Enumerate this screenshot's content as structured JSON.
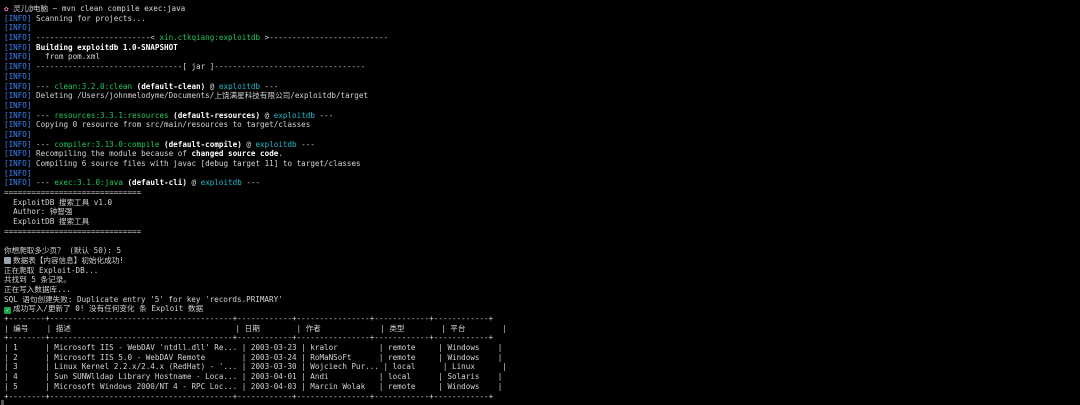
{
  "prompt": {
    "text": "灵儿@电脑 ~ mvn clean compile exec:java"
  },
  "info_tag": "[INFO]",
  "mvn": {
    "scanning": "Scanning for projects...",
    "artifact_prefix": "-------------------------< ",
    "artifact": "xin.ctkqiang:exploitdb",
    "artifact_suffix": " >--------------------------",
    "building": "Building exploitdb 1.0-SNAPSHOT",
    "from_pom": "  from pom.xml",
    "jar_rule": "--------------------------------[ jar ]---------------------------------",
    "clean_dash": "--- ",
    "clean_plugin": "clean:3.2.0:clean",
    "clean_goal": " (default-clean)",
    "at": " @ ",
    "project": "exploitdb",
    "tail_dash": " ---",
    "deleting": "Deleting /Users/johnmelodyme/Documents/上饶满星科技有限公司/exploitdb/target",
    "resources_plugin": "resources:3.3.1:resources",
    "resources_goal": " (default-resources)",
    "copying": "Copying 0 resource from src/main/resources to target/classes",
    "compiler_plugin": "compiler:3.13.0:compile",
    "compiler_goal": " (default-compile)",
    "recompiling_pre": "Recompiling the module because of ",
    "recompiling_bold": "changed source code",
    "recompiling_post": ".",
    "compiling": "Compiling 6 source files with javac [debug target 11] to target/classes",
    "exec_plugin": "exec:3.1.0:java",
    "exec_goal": " (default-cli)"
  },
  "banner": {
    "rule": "==============================",
    "line1": "  ExploitDB 搜索工具 v1.0",
    "line2": "  Author: 钟智强",
    "line3": "  ExploitDB 搜索工具"
  },
  "app": {
    "pages_question": "你想爬取多少页？ (默认 50): 5",
    "db_init": "数据表【内容信息】初始化成功!",
    "crawling": "正在爬取 Exploit-DB...",
    "found": "共找到 5 条记录。",
    "writing": "正在写入数据库...",
    "sql_error": "SQL 语句创建失败: Duplicate entry '5' for key 'records.PRIMARY'",
    "success": "成功写入/更新了 0! 没有任何变化 条 Exploit 数据"
  },
  "table": {
    "border_top": "+--------+----------------------------------------+------------+----------------+------------+------------+",
    "header": "| 编号    | 描述                                    | 日期        | 作者             | 类型        | 平台        |",
    "border_mid": "+--------+----------------------------------------+------------+----------------+------------+------------+",
    "rows": [
      "| 1      | Microsoft IIS - WebDAV 'ntdll.dll' Re... | 2003-03-23 | kralor         | remote     | Windows    |",
      "| 2      | Microsoft IIS 5.0 - WebDAV Remote        | 2003-03-24 | RoMaNSoFt      | remote     | Windows    |",
      "| 3      | Linux Kernel 2.2.x/2.4.x (RedHat) - '... | 2003-03-30 | Wojciech Pur... | local      | Linux      |",
      "| 4      | Sun SUNWlldap Library Hostname - Loca... | 2003-04-01 | Andi           | local      | Solaris    |",
      "| 5      | Microsoft Windows 2000/NT 4 - RPC Loc... | 2003-04-03 | Marcin Wolak   | remote     | Windows    |"
    ],
    "border_bottom": "+--------+----------------------------------------+------------+----------------+------------+------------+"
  },
  "colors": {
    "info": "#3b82f6",
    "plugin": "#22c55e",
    "project": "#22b8cf"
  }
}
